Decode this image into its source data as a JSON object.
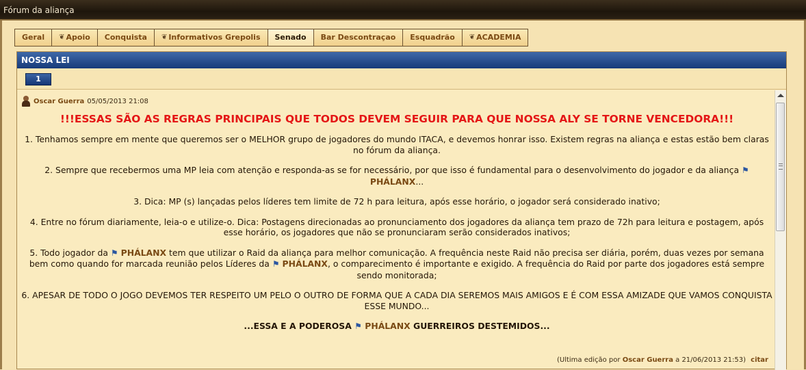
{
  "window": {
    "title": "Fórum da aliança"
  },
  "tabs": [
    {
      "label": "Geral",
      "icon": ""
    },
    {
      "label": "Apoio",
      "icon": "swirl-icon"
    },
    {
      "label": "Conquista",
      "icon": ""
    },
    {
      "label": "Informativos Grepolis",
      "icon": "swirl-icon"
    },
    {
      "label": "Senado",
      "icon": "",
      "active": true
    },
    {
      "label": "Bar Descontraçao",
      "icon": ""
    },
    {
      "label": "Esquadrão",
      "icon": ""
    },
    {
      "label": "ACADEMIA",
      "icon": "swirl-icon"
    }
  ],
  "thread": {
    "title": "NOSSA LEI",
    "page": "1"
  },
  "post": {
    "author": "Oscar Guerra",
    "date": "05/05/2013 21:08",
    "headline": "!!!ESSAS SÃO AS REGRAS PRINCIPAIS QUE TODOS DEVEM SEGUIR PARA QUE NOSSA ALY SE TORNE VENCEDORA!!!",
    "rule1": "1. Tenhamos sempre em mente que queremos ser o MELHOR grupo de jogadores do mundo ITACA, e devemos honrar isso. Existem regras na aliança e estas estão bem claras no fórum da aliança.",
    "rule2_a": "2. Sempre que recebermos uma MP leia com atenção e responda-as se for necessário, por que isso é fundamental para o desenvolvimento do jogador e da aliança",
    "rule2_b": "...",
    "rule3": "3. Dica: MP (s) lançadas pelos líderes tem limite de 72 h para leitura, após esse horário, o jogador será considerado inativo;",
    "rule4": "4. Entre no fórum diariamente, leia-o e utilize-o. Dica: Postagens direcionadas ao pronunciamento dos jogadores da aliança tem prazo de 72h para leitura e postagem, após esse horário, os jogadores que não se pronunciaram serão considerados inativos;",
    "rule5_a": "5. Todo jogador da",
    "rule5_b": "tem que utilizar o Raid da aliança para melhor comunicação. A frequência neste Raid não precisa ser diária, porém, duas vezes por semana bem como quando for marcada reunião pelos Líderes da",
    "rule5_c": ", o comparecimento é importante e exigido. A frequência do Raid por parte dos jogadores está sempre sendo monitorada;",
    "rule6": "6. APESAR DE TODO O JOGO DEVEMOS TER RESPEITO UM PELO O OUTRO DE FORMA QUE A CADA DIA SEREMOS MAIS AMIGOS E É COM ESSA AMIZADE QUE VAMOS CONQUISTA ESSE MUNDO...",
    "closing_a": "...ESSA E A PODEROSA",
    "closing_b": "GUERREIROS DESTEMIDOS...",
    "alliance_name": "PHÁLANX",
    "alliance_color": "#7a4a14",
    "headline_color": "#e41616",
    "edit_prefix": "(Ultima edição por",
    "edit_author": "Oscar Guerra",
    "edit_suffix": "a 21/06/2013 21:53)",
    "quote_label": "citar"
  }
}
